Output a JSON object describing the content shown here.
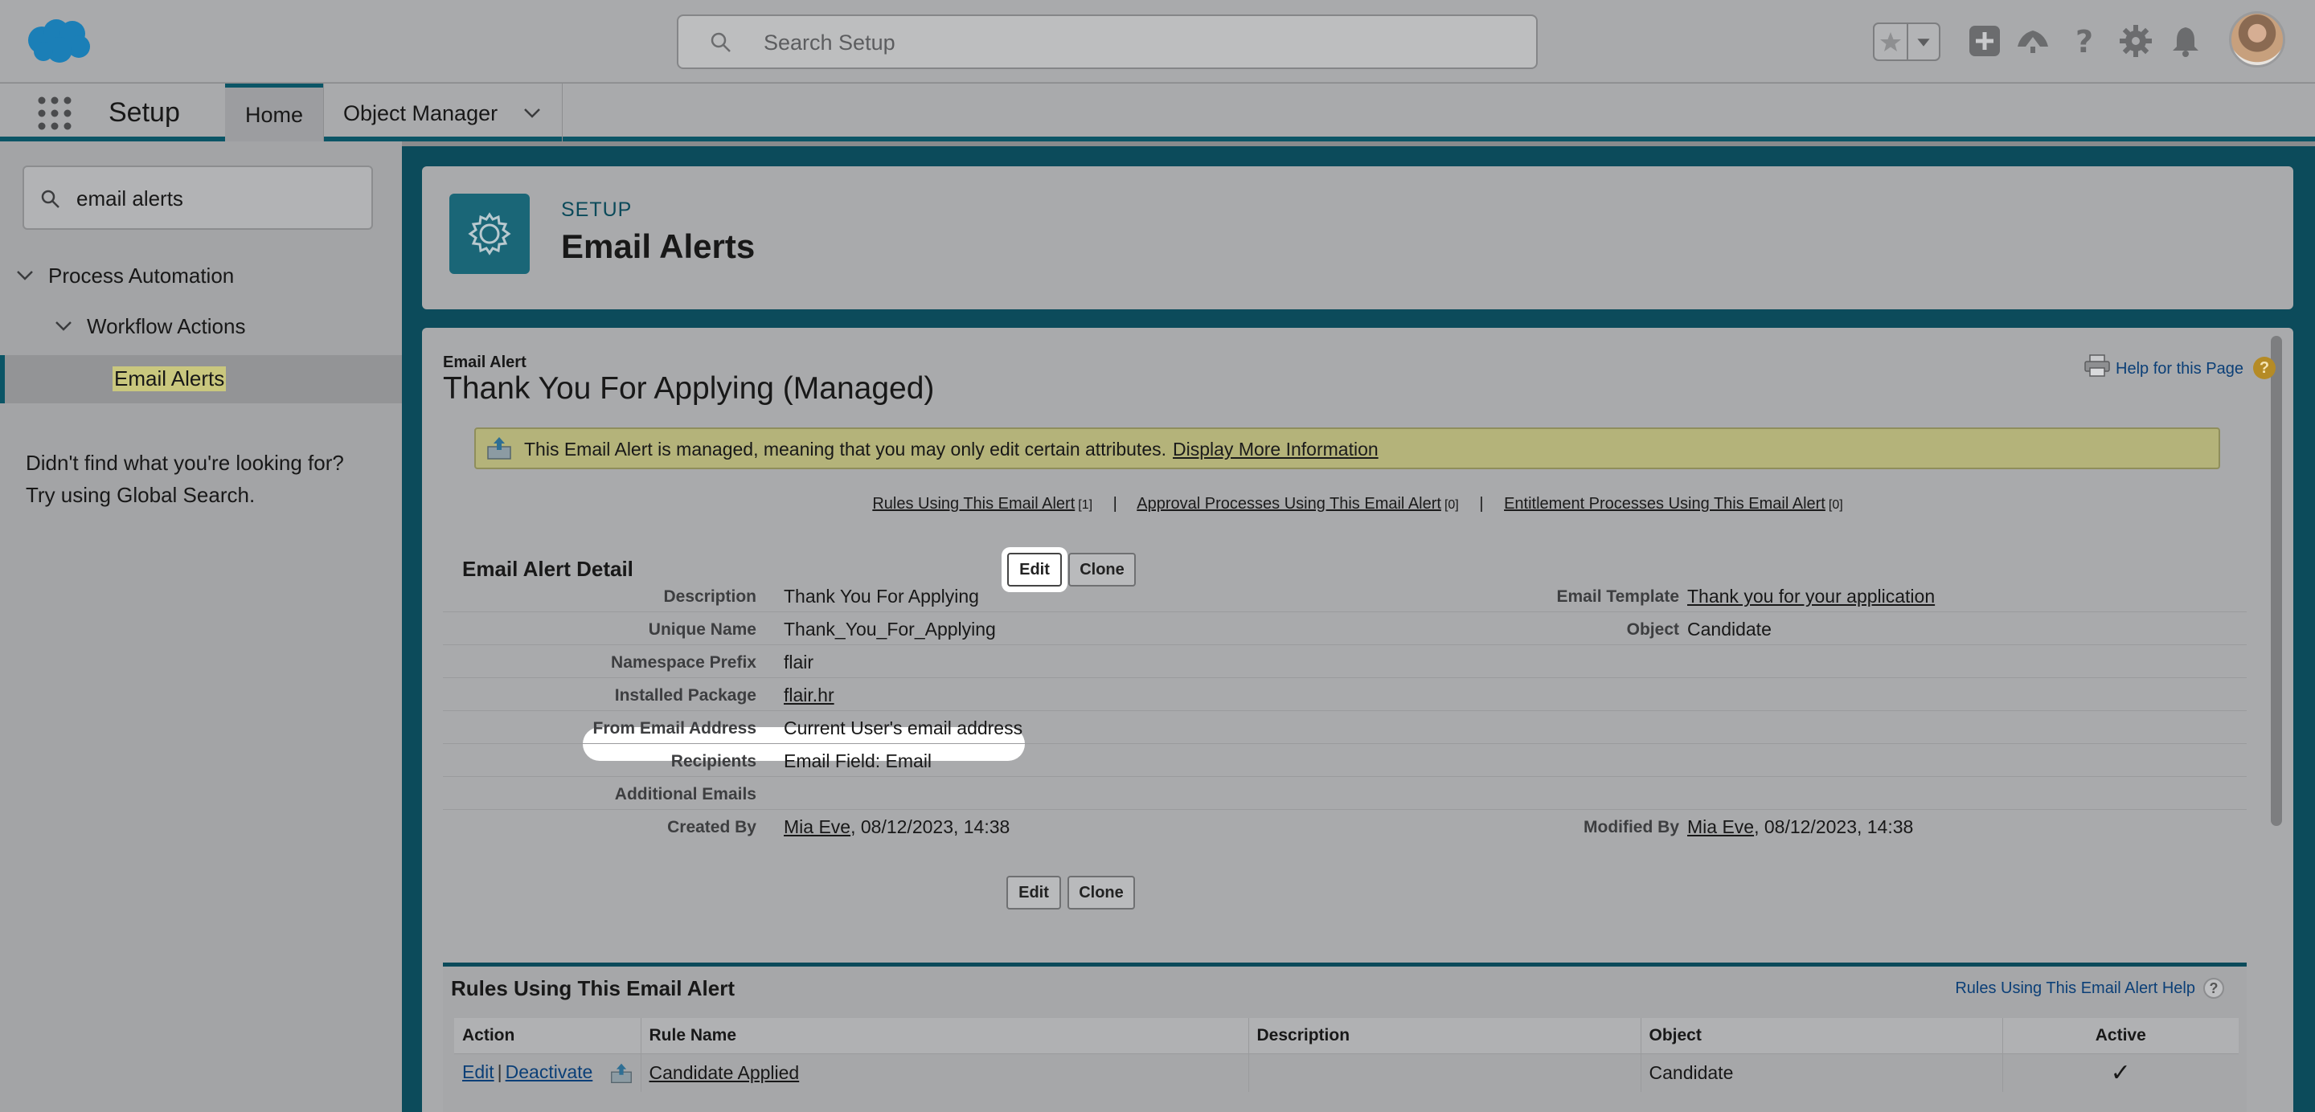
{
  "header": {
    "search_placeholder": "Search Setup"
  },
  "nav": {
    "app_name": "Setup",
    "tabs": [
      {
        "label": "Home",
        "active": true
      },
      {
        "label": "Object Manager",
        "active": false
      }
    ]
  },
  "sidebar": {
    "quick_find_value": "email alerts",
    "tree": {
      "level1": "Process Automation",
      "level2": "Workflow Actions",
      "level3": "Email Alerts"
    },
    "not_found_line1": "Didn't find what you're looking for?",
    "not_found_line2": "Try using Global Search."
  },
  "page_header": {
    "eyebrow": "SETUP",
    "title": "Email Alerts"
  },
  "detail": {
    "object_label": "Email Alert",
    "title": "Thank You For Applying (Managed)",
    "help_link": "Help for this Page",
    "managed_message": "This Email Alert is managed, meaning that you may only edit certain attributes.",
    "managed_link": "Display More Information",
    "related_links": [
      {
        "label": "Rules Using This Email Alert",
        "count": "[1]"
      },
      {
        "label": "Approval Processes Using This Email Alert",
        "count": "[0]"
      },
      {
        "label": "Entitlement Processes Using This Email Alert",
        "count": "[0]"
      }
    ],
    "section_title": "Email Alert Detail",
    "edit_label": "Edit",
    "clone_label": "Clone",
    "fields": {
      "description": {
        "label": "Description",
        "value": "Thank You For Applying"
      },
      "unique_name": {
        "label": "Unique Name",
        "value": "Thank_You_For_Applying"
      },
      "namespace_prefix": {
        "label": "Namespace Prefix",
        "value": "flair"
      },
      "installed_package": {
        "label": "Installed Package",
        "value": "flair.hr"
      },
      "from_email": {
        "label": "From Email Address",
        "value": "Current User's email address"
      },
      "recipients": {
        "label": "Recipients",
        "value": "Email Field: Email"
      },
      "additional_emails": {
        "label": "Additional Emails",
        "value": ""
      },
      "created_by": {
        "label": "Created By",
        "user": "Mia Eve",
        "date": ", 08/12/2023, 14:38"
      },
      "email_template": {
        "label": "Email Template",
        "value": "Thank you for your application"
      },
      "object": {
        "label": "Object",
        "value": "Candidate"
      },
      "modified_by": {
        "label": "Modified By",
        "user": "Mia Eve",
        "date": ", 08/12/2023, 14:38"
      }
    }
  },
  "rules": {
    "title": "Rules Using This Email Alert",
    "help_link": "Rules Using This Email Alert Help",
    "columns": [
      "Action",
      "Rule Name",
      "Description",
      "Object",
      "Active"
    ],
    "rows": [
      {
        "edit": "Edit",
        "deactivate": "Deactivate",
        "rule_name": "Candidate Applied",
        "description": "",
        "object": "Candidate",
        "active": "✓"
      }
    ]
  },
  "colors": {
    "brand_teal": "#0b5566",
    "salesforce_blue": "#1b96d8",
    "link": "#0b3f77"
  }
}
